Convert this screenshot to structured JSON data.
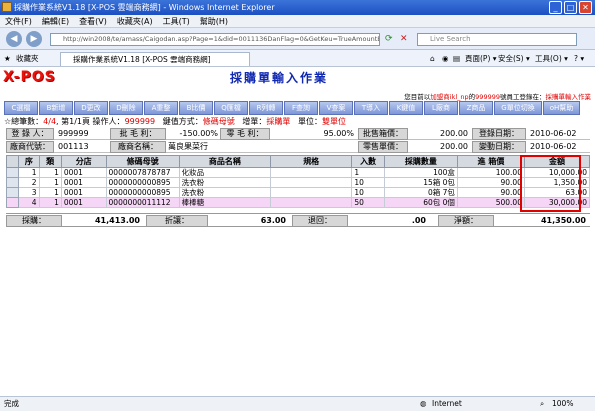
{
  "window": {
    "title": "採購作業系統V1.18 [X-POS 雲端商務網] - Windows Internet Explorer",
    "min": "_",
    "max": "□",
    "close": "✕"
  },
  "menu": [
    "文件(F)",
    "編輯(E)",
    "查看(V)",
    "收藏夾(A)",
    "工具(T)",
    "幫助(H)"
  ],
  "address": {
    "url": "http://win2008/te/amass/Caigodan.asp?Page=1&did=0011136DanFlag=0&GetKeu=TrueAmountExn=True",
    "search_placeholder": "Live Search"
  },
  "tabs": {
    "favorites": "收藏夾",
    "active": "採購作業系統V1.18 [X-POS 雲端商務網]",
    "tools_page": "頁面(P) ▾",
    "tools_safety": "安全(S) ▾",
    "tools_tools": "工具(O) ▾",
    "tools_help": "? ▾"
  },
  "app": {
    "logo": "X-POS",
    "form_title": "採購單輸入作業"
  },
  "notice": {
    "prefix": "您目前以",
    "user": "加盟商ikl_np",
    "mid": "的",
    "code": "999999",
    "suffix": "號員工登錄在：",
    "location": "採購單輸入作業"
  },
  "toolbar": [
    "C選檔",
    "B新增",
    "D更改",
    "D刪除",
    "A重整",
    "B比價",
    "Q匯檔",
    "R列轉",
    "F查詢",
    "V查案",
    "T導入",
    "K鍵值",
    "L廠商",
    "Z商品",
    "G單位切換",
    "oH幫助"
  ],
  "info": {
    "total_prefix": "☆總筆數：",
    "total": "4/4",
    "page_prefix": ", 第",
    "page": "1/1",
    "page_suffix": "頁  操作人：",
    "operator": "999999",
    "keymode_label": "鍵值方式：",
    "keymode": "條碼母號",
    "addtype_label": "增單：",
    "addtype": "採購單",
    "unit_label": "單位：",
    "unit": "雙單位"
  },
  "header": {
    "login_person_label": "登 錄 人：",
    "login_person": "999999",
    "gross_margin_label": "批 毛 利：",
    "gross_margin": "-150.00%",
    "retail_margin_label": "零 毛 利：",
    "retail_margin": "95.00%",
    "wholesale_price_label": "批售箱價：",
    "wholesale_price": "200.00",
    "login_date_label": "登錄日期：",
    "login_date": "2010-06-02",
    "vendor_code_label": "廠商代號：",
    "vendor_code": "001113",
    "vendor_name_label": "廠商名稱：",
    "vendor_name": "萬良果菜行",
    "retail_price_label": "零售單價：",
    "retail_price": "200.00",
    "change_date_label": "變動日期：",
    "change_date": "2010-06-02"
  },
  "table": {
    "columns": [
      "序",
      "類",
      "分店",
      "條碼母號",
      "商品名稱",
      "規格",
      "入數",
      "採購數量",
      "進 箱價",
      "金額"
    ],
    "rows": [
      {
        "seq": "1",
        "type": "1",
        "store": "0001",
        "barcode": "0000007878787",
        "name": "化妝品",
        "spec": "",
        "qty_in": "1",
        "qty": "100盒",
        "price": "100.00",
        "amount": "10,000.00",
        "selected": false
      },
      {
        "seq": "2",
        "type": "1",
        "store": "0001",
        "barcode": "0000000000895",
        "name": "洗衣粉",
        "spec": "",
        "qty_in": "10",
        "qty": "15箱    0包",
        "price": "90.00",
        "amount": "1,350.00",
        "selected": false
      },
      {
        "seq": "3",
        "type": "1",
        "store": "0001",
        "barcode": "0000000000895",
        "name": "洗衣粉",
        "spec": "",
        "qty_in": "10",
        "qty": "0箱    7包",
        "price": "90.00",
        "amount": "63.00",
        "selected": false
      },
      {
        "seq": "4",
        "type": "1",
        "store": "0001",
        "barcode": "0000000011112",
        "name": "棒棒糖",
        "spec": "",
        "qty_in": "50",
        "qty": "60包    0個",
        "price": "500.00",
        "amount": "30,000.00",
        "selected": true
      }
    ]
  },
  "totals": {
    "purchase_label": "採購：",
    "purchase": "41,413.00",
    "discount_label": "折讓：",
    "discount": "63.00",
    "return_label": "退回：",
    "return": ".00",
    "net_label": "淨額：",
    "net": "41,350.00"
  },
  "status": {
    "left": "完成",
    "zone": "Internet",
    "zoom": "100%"
  }
}
